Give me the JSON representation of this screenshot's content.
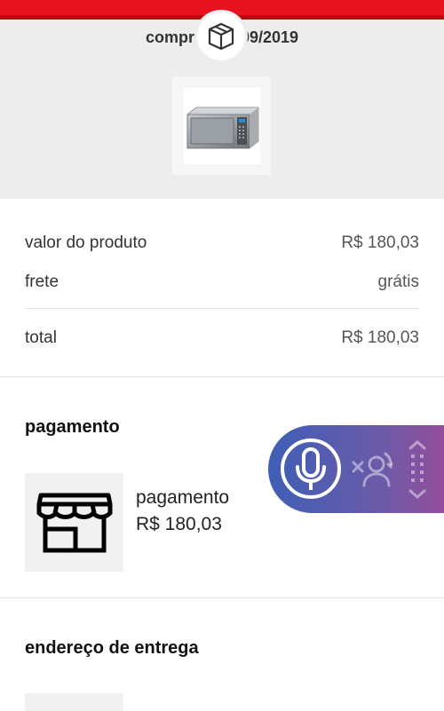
{
  "order": {
    "purchased_text": "comprado     0/09/2019",
    "box_icon": "package-box-icon",
    "product_image": "microwave-oven-image"
  },
  "summary": {
    "product_value_label": "valor do produto",
    "product_value": "R$ 180,03",
    "shipping_label": "frete",
    "shipping_value": "grátis",
    "total_label": "total",
    "total_value": "R$ 180,03"
  },
  "payment": {
    "section_title": "pagamento",
    "method_icon": "storefront-icon",
    "method_name": "pagamento",
    "method_amount": "R$ 180,03"
  },
  "delivery": {
    "section_title": "endereço de entrega"
  },
  "voice_assistant": {
    "mic_icon": "microphone-icon",
    "hide_icon": "hide-assistant-icon",
    "drag_icon": "drag-handle-icon"
  },
  "colors": {
    "brand_red": "#e8111e",
    "header_bg": "#ededed",
    "pill_gradient_start": "#3f5fb6",
    "pill_gradient_end": "#9a4c9a"
  }
}
